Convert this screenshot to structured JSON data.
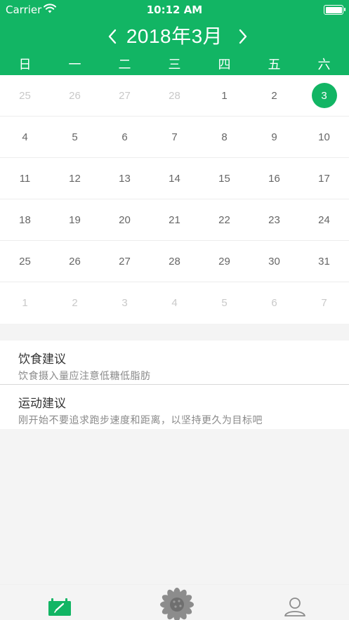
{
  "status_bar": {
    "carrier": "Carrier",
    "time": "10:12 AM"
  },
  "calendar": {
    "title": "2018年3月",
    "weekdays": [
      "日",
      "一",
      "二",
      "三",
      "四",
      "五",
      "六"
    ],
    "selected_day": "3",
    "weeks": [
      [
        {
          "day": "25",
          "state": "muted"
        },
        {
          "day": "26",
          "state": "muted"
        },
        {
          "day": "27",
          "state": "muted"
        },
        {
          "day": "28",
          "state": "muted"
        },
        {
          "day": "1",
          "state": "normal"
        },
        {
          "day": "2",
          "state": "normal"
        },
        {
          "day": "3",
          "state": "selected"
        }
      ],
      [
        {
          "day": "4",
          "state": "normal"
        },
        {
          "day": "5",
          "state": "normal"
        },
        {
          "day": "6",
          "state": "normal"
        },
        {
          "day": "7",
          "state": "normal"
        },
        {
          "day": "8",
          "state": "normal"
        },
        {
          "day": "9",
          "state": "normal"
        },
        {
          "day": "10",
          "state": "normal"
        }
      ],
      [
        {
          "day": "11",
          "state": "normal"
        },
        {
          "day": "12",
          "state": "normal"
        },
        {
          "day": "13",
          "state": "normal"
        },
        {
          "day": "14",
          "state": "normal"
        },
        {
          "day": "15",
          "state": "normal"
        },
        {
          "day": "16",
          "state": "normal"
        },
        {
          "day": "17",
          "state": "normal"
        }
      ],
      [
        {
          "day": "18",
          "state": "normal"
        },
        {
          "day": "19",
          "state": "normal"
        },
        {
          "day": "20",
          "state": "normal"
        },
        {
          "day": "21",
          "state": "normal"
        },
        {
          "day": "22",
          "state": "normal"
        },
        {
          "day": "23",
          "state": "normal"
        },
        {
          "day": "24",
          "state": "normal"
        }
      ],
      [
        {
          "day": "25",
          "state": "normal"
        },
        {
          "day": "26",
          "state": "normal"
        },
        {
          "day": "27",
          "state": "normal"
        },
        {
          "day": "28",
          "state": "normal"
        },
        {
          "day": "29",
          "state": "normal"
        },
        {
          "day": "30",
          "state": "normal"
        },
        {
          "day": "31",
          "state": "normal"
        }
      ],
      [
        {
          "day": "1",
          "state": "muted"
        },
        {
          "day": "2",
          "state": "muted"
        },
        {
          "day": "3",
          "state": "muted"
        },
        {
          "day": "4",
          "state": "muted"
        },
        {
          "day": "5",
          "state": "muted"
        },
        {
          "day": "6",
          "state": "muted"
        },
        {
          "day": "7",
          "state": "muted"
        }
      ]
    ]
  },
  "advice": {
    "diet": {
      "title": "饮食建议",
      "description": "饮食摄入量应注意低糖低脂肪"
    },
    "exercise": {
      "title": "运动建议",
      "description": "刚开始不要追求跑步速度和距离，以坚持更久为目标吧"
    }
  },
  "tabbar": {
    "tabs": [
      {
        "icon": "diary-icon",
        "active": true
      },
      {
        "icon": "sunflower-icon",
        "active": false
      },
      {
        "icon": "profile-icon",
        "active": false
      }
    ]
  },
  "colors": {
    "accent": "#12b564",
    "background": "#f4f4f4",
    "muted_text": "#c9c9c9",
    "body_text": "#666666"
  }
}
